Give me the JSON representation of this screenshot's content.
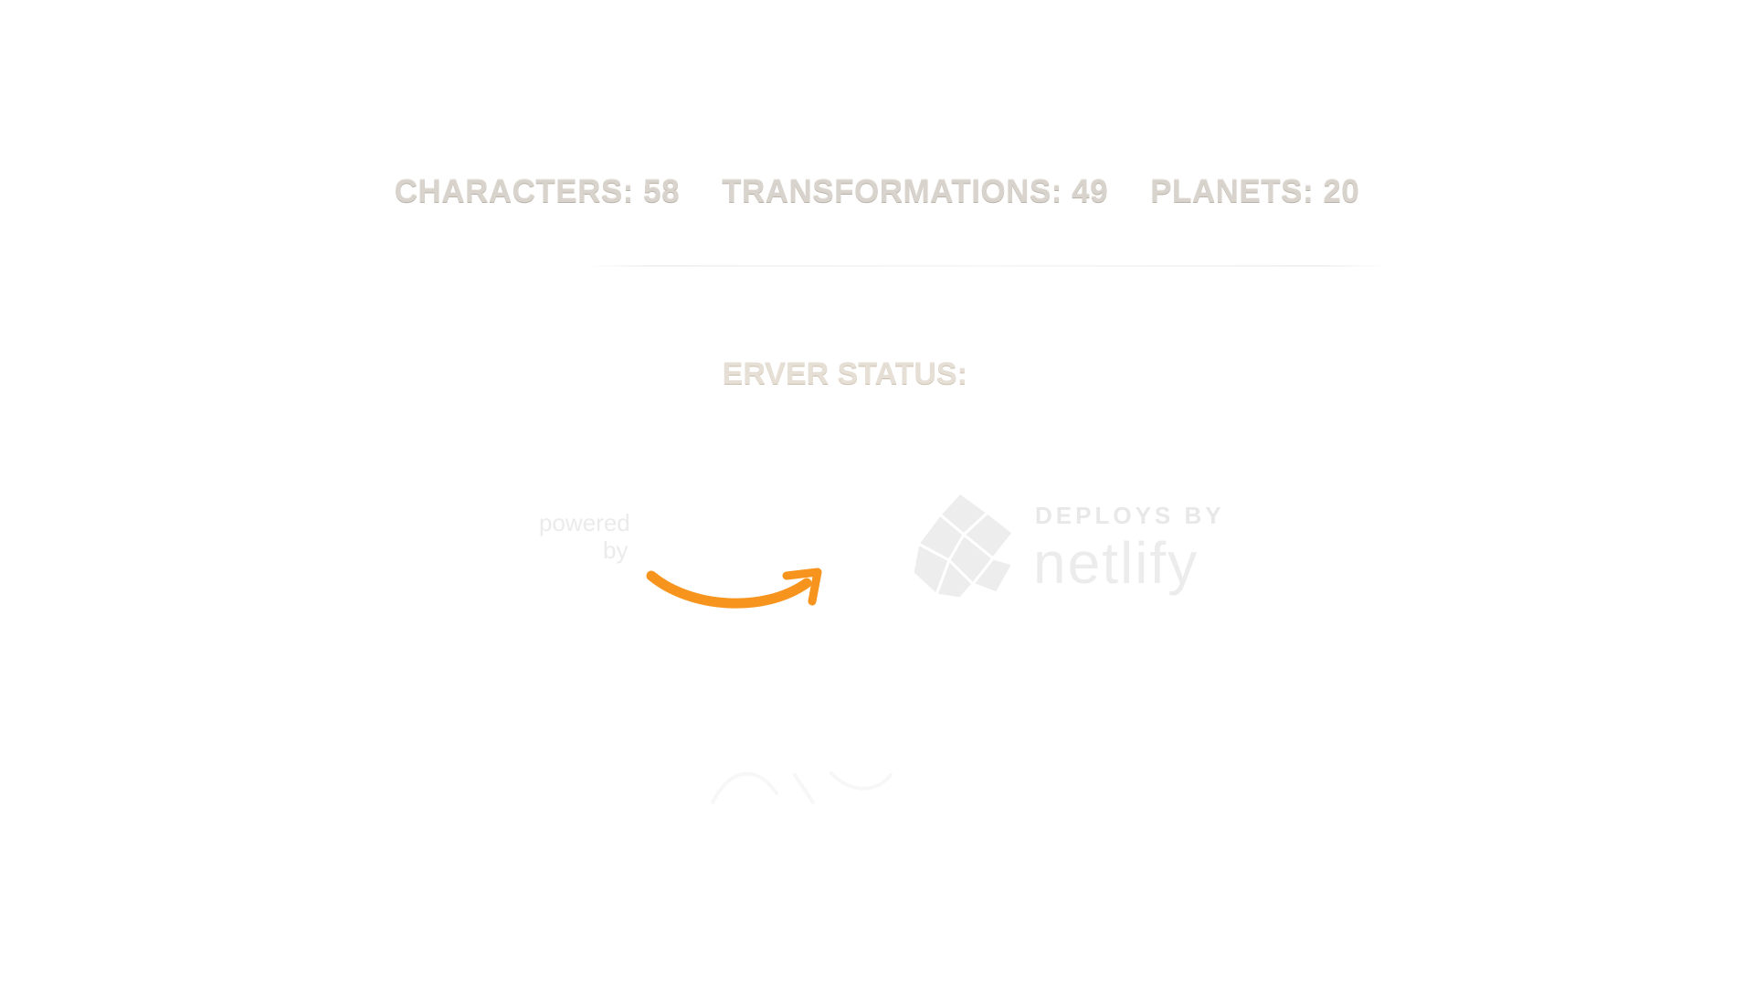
{
  "stats": {
    "characters": "CHARACTERS: 58",
    "transformations": "TRANSFORMATIONS: 49",
    "planets": "PLANETS: 20"
  },
  "server_status": {
    "label": "SERVER STATUS:"
  },
  "sponsors": {
    "aws": {
      "line1": "powered",
      "line2": "by",
      "smile_color": "#f7941d"
    },
    "netlify": {
      "deploys_label": "DEPLOYS BY",
      "wordmark": "netlify"
    }
  },
  "colors": {
    "background": "#ffffff",
    "stat_text": "#d8d3cc",
    "aws_orange": "#f7941d"
  }
}
